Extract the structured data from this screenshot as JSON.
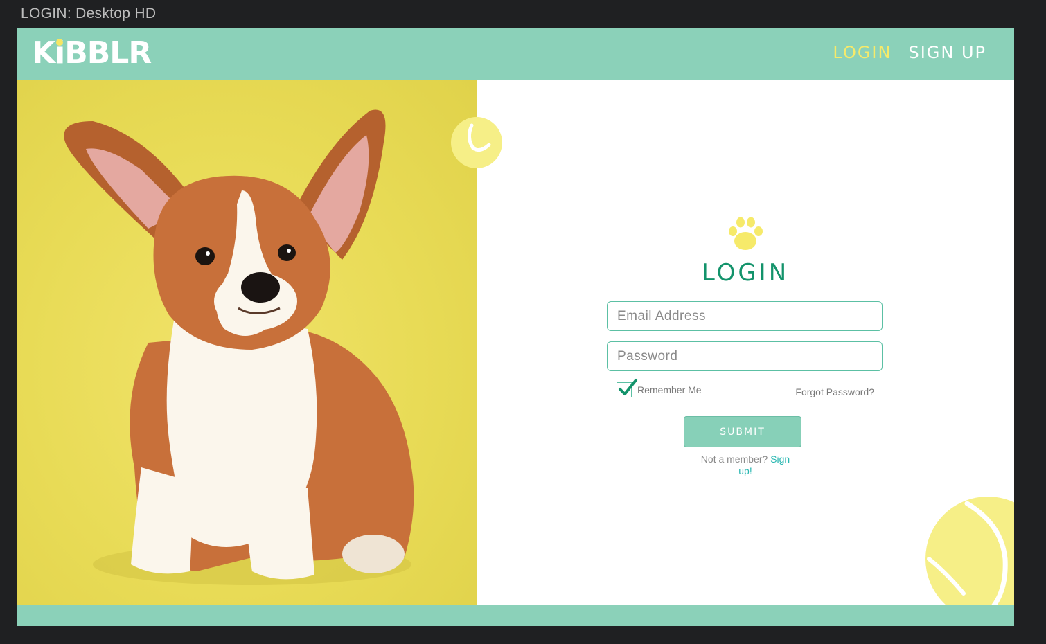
{
  "frame": {
    "title": "LOGIN: Desktop HD"
  },
  "header": {
    "logo": {
      "pre": "K",
      "i": "i",
      "post": "BBLR"
    },
    "nav": {
      "login": "LOGIN",
      "signup": "SIGN UP"
    }
  },
  "form": {
    "title": "LOGIN",
    "email": {
      "value": "",
      "placeholder": "Email Address"
    },
    "password": {
      "value": "",
      "placeholder": "Password"
    },
    "remember": {
      "label": "Remember Me",
      "checked": true
    },
    "forgot_label": "Forgot Password?",
    "submit_label": "SUBMIT",
    "not_member": "Not a member?",
    "signup_link": "Sign up!"
  },
  "colors": {
    "mint": "#8bd1b9",
    "yellow": "#f6ea6a",
    "green": "#13936b",
    "link": "#26b6b0"
  },
  "icons": [
    "paw-icon",
    "check-icon",
    "tennis-ball-icon"
  ]
}
